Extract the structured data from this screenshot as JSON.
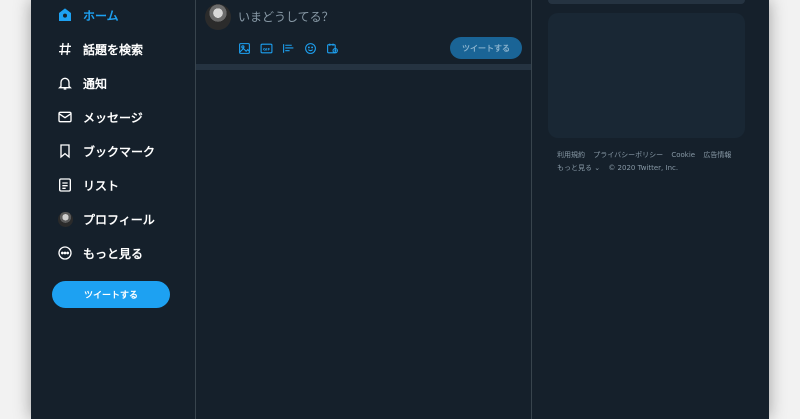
{
  "sidebar": {
    "items": [
      {
        "label": "ホーム",
        "icon": "home-icon"
      },
      {
        "label": "話題を検索",
        "icon": "hashtag-icon"
      },
      {
        "label": "通知",
        "icon": "bell-icon"
      },
      {
        "label": "メッセージ",
        "icon": "mail-icon"
      },
      {
        "label": "ブックマーク",
        "icon": "bookmark-icon"
      },
      {
        "label": "リスト",
        "icon": "list-icon"
      },
      {
        "label": "プロフィール",
        "icon": "avatar-icon"
      },
      {
        "label": "もっと見る",
        "icon": "more-icon"
      }
    ],
    "tweet_button": "ツイートする"
  },
  "compose": {
    "placeholder": "いまどうしてる？",
    "tools": [
      "image-icon",
      "gif-icon",
      "poll-icon",
      "emoji-icon",
      "schedule-icon"
    ],
    "tweet_button": "ツイートする"
  },
  "footer": {
    "links": [
      "利用規約",
      "プライバシーポリシー",
      "Cookie",
      "広告情報"
    ],
    "more": "もっと見る ⌄",
    "copyright": "© 2020 Twitter, Inc."
  },
  "colors": {
    "background": "#15202b",
    "accent": "#1da1f2",
    "border": "#38444d",
    "muted_text": "#8899a6"
  }
}
